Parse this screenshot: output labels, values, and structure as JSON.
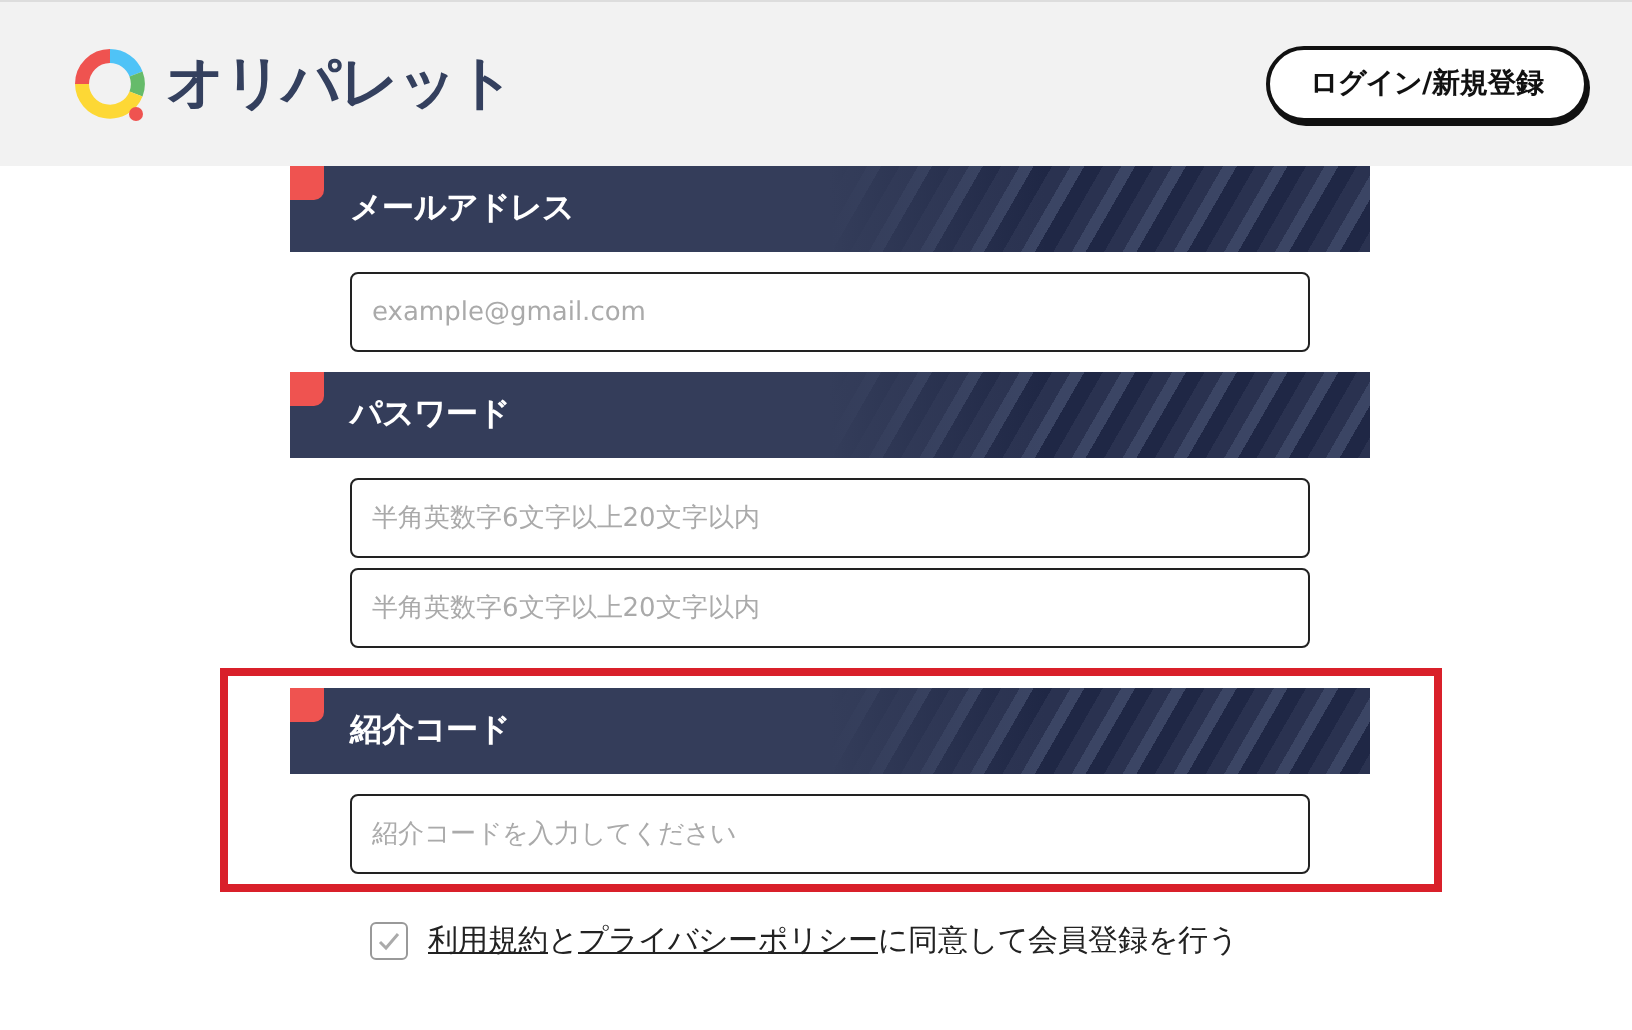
{
  "header": {
    "logo_text": "オリパレット",
    "login_button": "ログイン/新規登録"
  },
  "sections": [
    {
      "title": "メールアドレス",
      "highlighted": false,
      "fields": [
        {
          "placeholder": "example@gmail.com"
        }
      ]
    },
    {
      "title": "パスワード",
      "highlighted": false,
      "fields": [
        {
          "placeholder": "半角英数字6文字以上20文字以内"
        },
        {
          "placeholder": "半角英数字6文字以上20文字以内"
        }
      ]
    },
    {
      "title": "紹介コード",
      "highlighted": true,
      "fields": [
        {
          "placeholder": "紹介コードを入力してください"
        }
      ]
    }
  ],
  "agreement": {
    "checked": true,
    "parts": [
      {
        "text": "利用規約",
        "link": true
      },
      {
        "text": "と",
        "link": false
      },
      {
        "text": "プライバシーポリシー",
        "link": true
      },
      {
        "text": "に同意して会員登録を行う",
        "link": false
      }
    ]
  }
}
